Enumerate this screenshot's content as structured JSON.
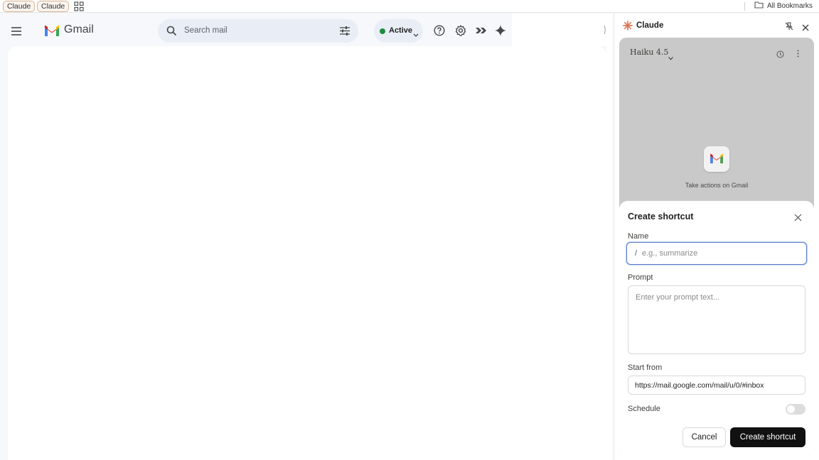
{
  "bookmarks": {
    "items": [
      {
        "label": "Claude"
      },
      {
        "label": "Claude"
      }
    ],
    "all_label": "All Bookmarks"
  },
  "gmail": {
    "title": "Gmail",
    "search_placeholder": "Search mail",
    "status_label": "Active",
    "status_color": "#1e8e3e",
    "icons": [
      "menu-icon",
      "search-icon",
      "filter-icon",
      "help-icon",
      "settings-icon",
      "apps-script-icon",
      "gemini-icon"
    ]
  },
  "claude": {
    "title": "Claude",
    "model": "Haiku 4.5",
    "caption": "Take actions on Gmail",
    "accent": "#d97757",
    "modal": {
      "title": "Create shortcut",
      "name_label": "Name",
      "name_prefix": "/",
      "name_placeholder": "e.g., summarize",
      "prompt_label": "Prompt",
      "prompt_placeholder": "Enter your prompt text...",
      "start_label": "Start from",
      "start_value": "https://mail.google.com/mail/u/0/#inbox",
      "schedule_label": "Schedule",
      "schedule_on": false,
      "cancel_label": "Cancel",
      "create_label": "Create shortcut"
    }
  }
}
